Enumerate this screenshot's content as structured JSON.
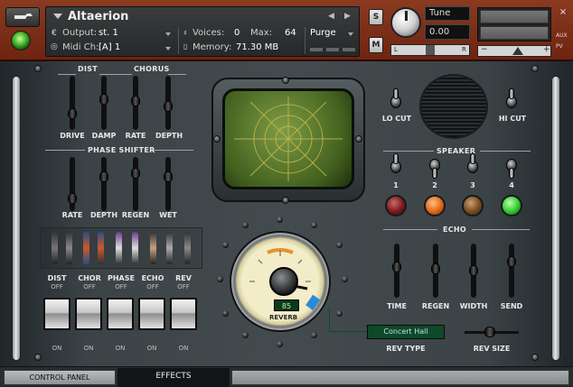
{
  "header": {
    "instrument_name": "Altaerion",
    "output_label": "Output:",
    "output_value": "st. 1",
    "midi_label": "Midi Ch:",
    "midi_value": "[A] 1",
    "voices_label": "Voices:",
    "voices_value": "0",
    "max_label": "Max:",
    "max_value": "64",
    "purge_label": "Purge",
    "memory_label": "Memory:",
    "memory_value": "71.30 MB",
    "solo_label": "S",
    "mute_label": "M",
    "tune_label": "Tune",
    "tune_value": "0.00",
    "pan_left": "L",
    "pan_right": "R",
    "vol_minus": "−",
    "vol_plus": "+",
    "close": "×",
    "aux_label": "AUX",
    "pv_label": "PV"
  },
  "effects": {
    "dist_title": "DIST",
    "chorus_title": "CHORUS",
    "dist_faders": [
      "DRIVE",
      "DAMP"
    ],
    "chorus_faders": [
      "RATE",
      "DEPTH"
    ],
    "phaser_title": "PHASE SHIFTER",
    "phaser_faders": [
      "RATE",
      "DEPTH",
      "REGEN",
      "WET"
    ],
    "fx_switches": [
      {
        "label": "DIST",
        "state": "OFF",
        "bottom": "ON"
      },
      {
        "label": "CHOR",
        "state": "OFF",
        "bottom": "ON"
      },
      {
        "label": "PHASE",
        "state": "OFF",
        "bottom": "ON"
      },
      {
        "label": "ECHO",
        "state": "OFF",
        "bottom": "ON"
      },
      {
        "label": "REV",
        "state": "OFF",
        "bottom": "ON"
      }
    ]
  },
  "filters": {
    "lo_cut": "LO CUT",
    "hi_cut": "HI CUT"
  },
  "speaker": {
    "title": "SPEAKER",
    "numbers": [
      "1",
      "2",
      "3",
      "4"
    ],
    "led_colors": [
      "#7a1a1a",
      "#e0661a",
      "#7a4a20",
      "#32c832"
    ]
  },
  "echo": {
    "title": "ECHO",
    "faders": [
      "TIME",
      "REGEN",
      "WIDTH",
      "SEND"
    ]
  },
  "reverb": {
    "value": "85",
    "label": "REVERB",
    "type_value": "Concert Hall",
    "type_label": "REV TYPE",
    "size_label": "REV SIZE"
  },
  "tabs": {
    "control_panel": "CONTROL PANEL",
    "effects": "EFFECTS"
  }
}
